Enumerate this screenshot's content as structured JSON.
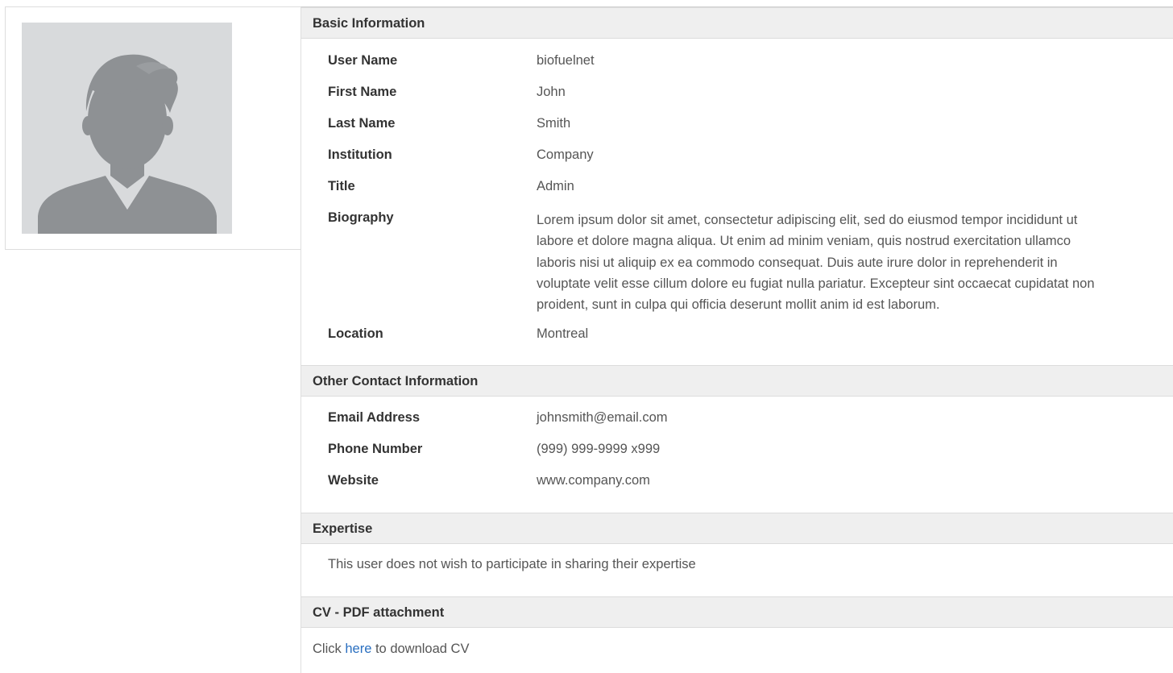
{
  "basic": {
    "header": "Basic Information",
    "rows": [
      {
        "label": "User Name",
        "value": "biofuelnet"
      },
      {
        "label": "First Name",
        "value": "John"
      },
      {
        "label": "Last Name",
        "value": "Smith"
      },
      {
        "label": "Institution",
        "value": "Company"
      },
      {
        "label": "Title",
        "value": "Admin"
      },
      {
        "label": "Biography"
      },
      {
        "label": "Location",
        "value": "Montreal"
      }
    ],
    "biography_lines": [
      "Lorem ipsum dolor sit amet, consectetur adipiscing elit, sed do eiusmod tempor incididunt ut",
      "labore et dolore magna aliqua. Ut enim ad minim veniam, quis nostrud exercitation ullamco",
      "laboris nisi ut aliquip ex ea commodo consequat. Duis aute irure dolor in reprehenderit in",
      "voluptate velit esse cillum dolore eu fugiat nulla pariatur. Excepteur sint occaecat cupidatat non",
      "proident, sunt in culpa qui officia deserunt mollit anim id est laborum."
    ]
  },
  "contact": {
    "header": "Other Contact Information",
    "rows": [
      {
        "label": "Email Address",
        "value": "johnsmith@email.com"
      },
      {
        "label": "Phone Number",
        "value": "(999) 999-9999 x999"
      },
      {
        "label": "Website",
        "value": "www.company.com"
      }
    ]
  },
  "expertise": {
    "header": "Expertise",
    "text": "This user does not wish to participate in sharing their expertise"
  },
  "cv": {
    "header": "CV - PDF attachment",
    "prefix": "Click",
    "link_text": "here",
    "suffix": "to download CV"
  },
  "colors": {
    "header_bg": "#efefef",
    "link": "#2a6fc0",
    "avatar_bg": "#d8dadc",
    "avatar_figure": "#8e9194"
  },
  "icons": {
    "avatar": "user-silhouette-icon"
  }
}
